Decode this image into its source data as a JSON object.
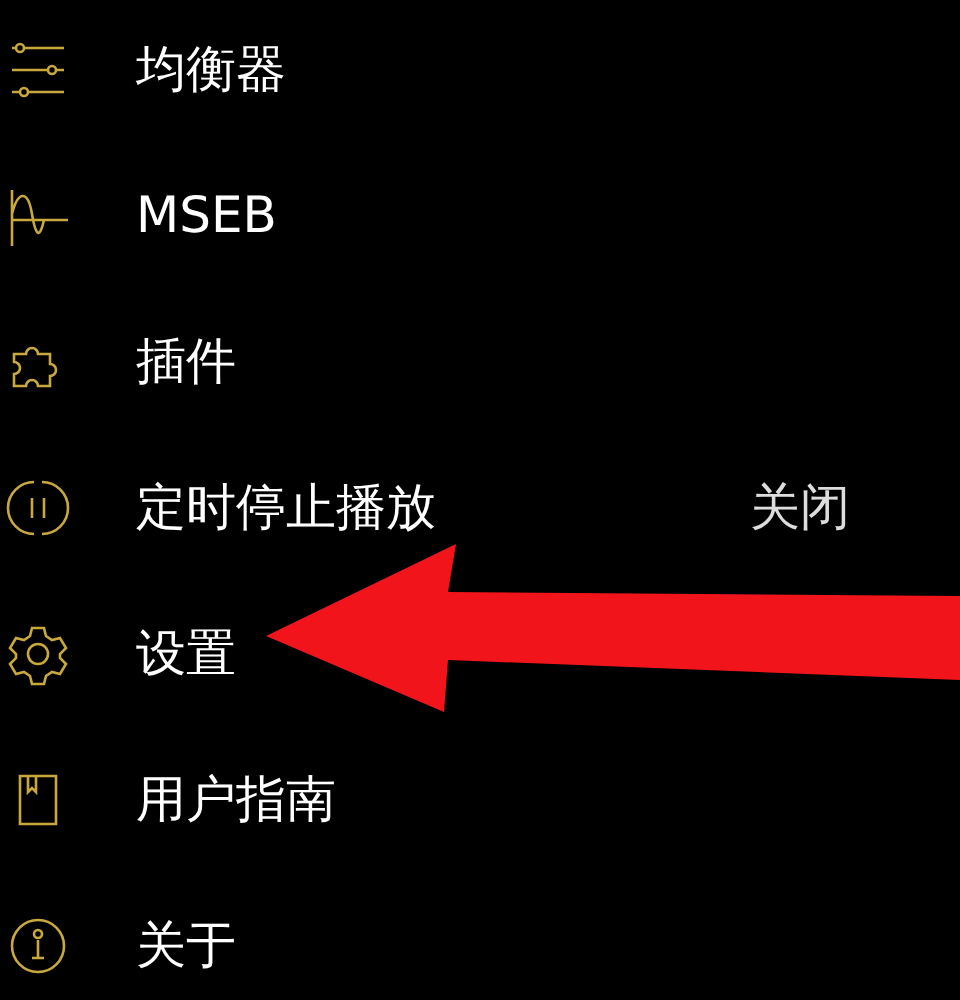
{
  "menu": [
    {
      "label": "均衡器"
    },
    {
      "label": "MSEB"
    },
    {
      "label": "插件"
    },
    {
      "label": "定时停止播放",
      "value": "关闭"
    },
    {
      "label": "设置"
    },
    {
      "label": "用户指南"
    },
    {
      "label": "关于"
    }
  ]
}
